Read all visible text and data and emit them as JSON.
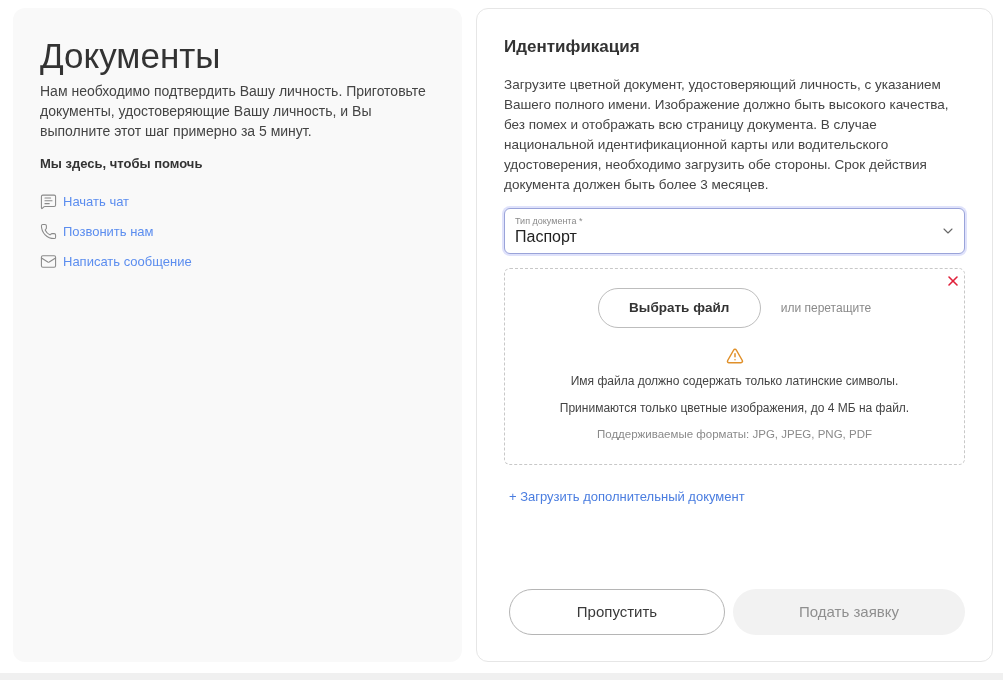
{
  "left_panel": {
    "title": "Документы",
    "description": "Нам необходимо подтвердить Вашу личность. Приготовьте документы, удостоверяющие Вашу личность, и Вы выполните этот шаг примерно за 5 минут.",
    "help_heading": "Мы здесь, чтобы помочь",
    "help_links": [
      {
        "kind": "chat",
        "label": "Начать чат"
      },
      {
        "kind": "phone",
        "label": "Позвонить нам"
      },
      {
        "kind": "mail",
        "label": "Написать сообщение"
      }
    ]
  },
  "form": {
    "title": "Идентификация",
    "instructions": "Загрузите цветной документ, удостоверяющий личность, с указанием Вашего полного имени. Изображение должно быть высокого качества, без помех и отображать всю страницу документа. В случае национальной идентификационной карты или водительского удостоверения, необходимо загрузить обе стороны. Срок действия документа должен быть более 3 месяцев.",
    "document_type": {
      "label": "Тип документа *",
      "value": "Паспорт",
      "focused": true
    },
    "upload": {
      "choose_button": "Выбрать файл",
      "drop_hint": "или перетащите",
      "warning_lines": [
        "Имя файла должно содержать только латинские символы.",
        "Принимаются только цветные изображения, до 4 МБ на файл."
      ],
      "formats": "Поддерживаемые форматы: JPG, JPEG, PNG, PDF"
    },
    "add_document_link": "+ Загрузить дополнительный документ",
    "buttons": [
      {
        "kind": "secondary",
        "label": "Пропустить",
        "disabled": false
      },
      {
        "kind": "primary",
        "label": "Подать заявку",
        "disabled": true
      }
    ]
  }
}
